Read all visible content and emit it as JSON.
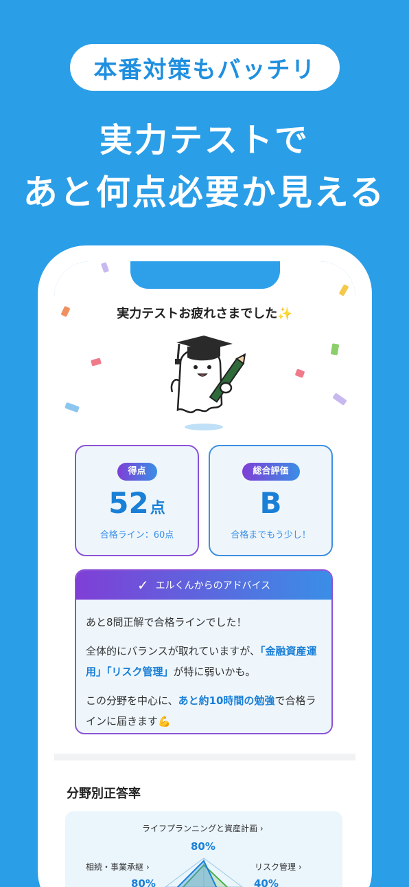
{
  "promo": {
    "badge": "本番対策もバッチリ",
    "headline_line1": "実力テストで",
    "headline_line2": "あと何点必要か見える"
  },
  "screen": {
    "title": "実力テストお疲れさまでした✨",
    "score_card": {
      "badge": "得点",
      "value": "52",
      "unit": "点",
      "sub": "合格ライン：60点"
    },
    "eval_card": {
      "badge": "総合評価",
      "value": "B",
      "sub": "合格までもう少し！"
    },
    "advice": {
      "header": "エルくんからのアドバイス",
      "p1": "あと8問正解で合格ラインでした！",
      "p2_a": "全体的にバランスが取れていますが、",
      "p2_hl1": "「金融資産運用」",
      "p2_hl2": "「リスク管理」",
      "p2_b": "が特に弱いかも。",
      "p3_a": "この分野を中心に、",
      "p3_hl": "あと約10時間の勉強",
      "p3_b": "で合格ラインに届きます💪"
    },
    "section_title": "分野別正答率",
    "radar": {
      "top_label": "ライフプランニングと資産計画 ›",
      "top_value": "80%",
      "left_label": "相続・事業承継 ›",
      "left_value": "80%",
      "right_label": "リスク管理 ›",
      "right_value": "40%"
    }
  },
  "colors": {
    "background": "#2b9ee8",
    "accent_blue": "#1a7fd6",
    "accent_purple": "#8a52d6"
  }
}
